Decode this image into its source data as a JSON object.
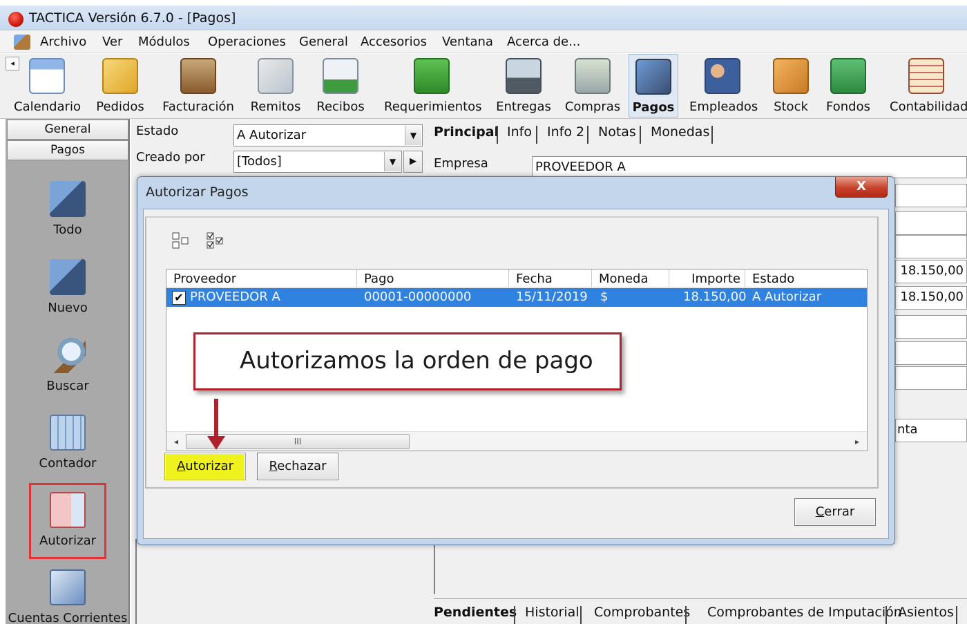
{
  "window": {
    "title": "TACTICA Versión 6.7.0 - [Pagos]"
  },
  "menu": [
    "Archivo",
    "Ver",
    "Módulos",
    "Operaciones",
    "General",
    "Accesorios",
    "Ventana",
    "Acerca de..."
  ],
  "toolbar": [
    {
      "label": "Calendario",
      "icon": "calendar-icon"
    },
    {
      "label": "Pedidos",
      "icon": "orders-icon"
    },
    {
      "label": "Facturación",
      "icon": "billing-icon"
    },
    {
      "label": "Remitos",
      "icon": "delivery-notes-icon"
    },
    {
      "label": "Recibos",
      "icon": "receipts-icon"
    },
    {
      "label": "Requerimientos",
      "icon": "requirements-icon"
    },
    {
      "label": "Entregas",
      "icon": "truck-icon"
    },
    {
      "label": "Compras",
      "icon": "cart-icon"
    },
    {
      "label": "Pagos",
      "icon": "payments-icon"
    },
    {
      "label": "Empleados",
      "icon": "employees-icon"
    },
    {
      "label": "Stock",
      "icon": "box-icon"
    },
    {
      "label": "Fondos",
      "icon": "money-icon"
    },
    {
      "label": "Contabilidad",
      "icon": "abacus-icon"
    }
  ],
  "sidebar": {
    "headers": [
      "General",
      "Pagos"
    ],
    "items": [
      {
        "label": "Todo",
        "icon": "folder-all-icon"
      },
      {
        "label": "Nuevo",
        "icon": "folder-new-icon"
      },
      {
        "label": "Buscar",
        "icon": "magnifier-icon"
      },
      {
        "label": "Contador",
        "icon": "calculator-icon"
      },
      {
        "label": "Autorizar",
        "icon": "authorize-icon"
      },
      {
        "label": "Cuentas Corrientes",
        "icon": "accounts-icon"
      }
    ]
  },
  "filters": {
    "estado_label": "Estado",
    "estado_value": "A Autorizar",
    "creado_label": "Creado por",
    "creado_value": "[Todos]"
  },
  "detail_tabs": [
    "Principal",
    "Info",
    "Info 2",
    "Notas",
    "Monedas"
  ],
  "empresa": {
    "label": "Empresa",
    "value": "PROVEEDOR A"
  },
  "right_values": [
    "18.150,00",
    "18.150,00",
    "nta"
  ],
  "dialog": {
    "title": "Autorizar Pagos",
    "close": "X",
    "columns": [
      "Proveedor",
      "Pago",
      "Fecha",
      "Moneda",
      "Importe",
      "Estado"
    ],
    "rows": [
      {
        "checked": "✔",
        "proveedor": "PROVEEDOR A",
        "pago": "00001-00000000",
        "fecha": "15/11/2019",
        "moneda": "$",
        "importe": "18.150,00",
        "estado": "A Autorizar"
      }
    ],
    "scroll_thumb": "III",
    "callout": "Autorizamos la orden de pago",
    "buttons": {
      "autorizar_u": "A",
      "autorizar_rest": "utorizar",
      "rechazar_u": "R",
      "rechazar_rest": "echazar",
      "cerrar_u": "C",
      "cerrar_rest": "errar"
    }
  },
  "bottom_tabs": [
    "Pendientes",
    "Historial",
    "Comprobantes",
    "Comprobantes de Imputación",
    "Asientos"
  ]
}
